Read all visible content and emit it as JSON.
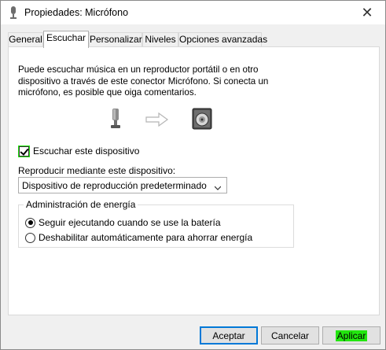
{
  "window": {
    "title": "Propiedades: Micrófono",
    "close_glyph": "✕"
  },
  "tabs": [
    {
      "label": "General",
      "active": false
    },
    {
      "label": "Escuchar",
      "active": true
    },
    {
      "label": "Personalizar",
      "active": false
    },
    {
      "label": "Niveles",
      "active": false
    },
    {
      "label": "Opciones avanzadas",
      "active": false
    }
  ],
  "listen": {
    "description": "Puede escuchar música en un reproductor portátil o en otro dispositivo a través de este conector Micrófono. Si conecta un micrófono, es posible que oiga comentarios.",
    "icons": [
      "microphone-icon",
      "arrow-right-icon",
      "speaker-icon"
    ],
    "listen_checkbox_label": "Escuchar este dispositivo",
    "listen_checked": true,
    "playback_label": "Reproducir mediante este dispositivo:",
    "playback_selected": "Dispositivo de reproducción predeterminado"
  },
  "power": {
    "legend": "Administración de energía",
    "options": [
      {
        "label": "Seguir ejecutando cuando se use la batería",
        "checked": true
      },
      {
        "label": "Deshabilitar automáticamente para ahorrar energía",
        "checked": false
      }
    ]
  },
  "buttons": {
    "accept": "Aceptar",
    "cancel": "Cancelar",
    "apply": "Aplicar"
  },
  "colors": {
    "highlight": "#22e60f",
    "accent": "#0078d7"
  }
}
